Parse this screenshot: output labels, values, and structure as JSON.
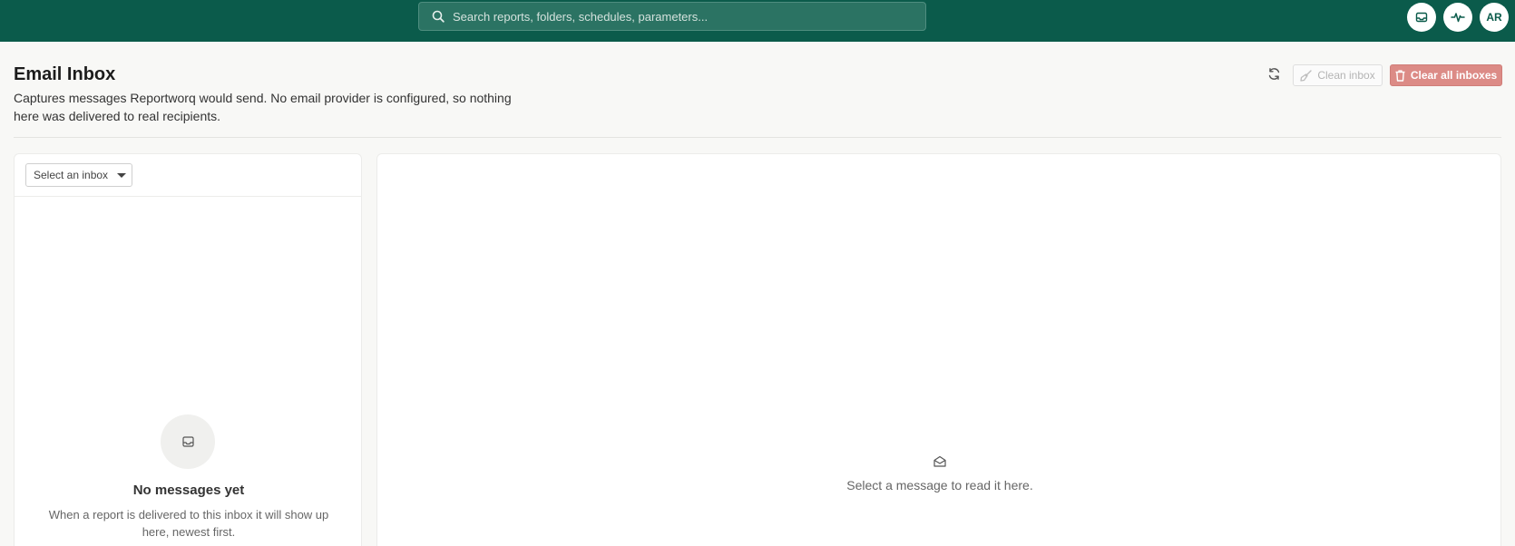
{
  "topbar": {
    "search_placeholder": "Search reports, folders, schedules, parameters...",
    "icons": [
      "inbox-icon",
      "activity-icon"
    ],
    "avatar_initials": "AR",
    "background_color": "#0b5b4b"
  },
  "header": {
    "title": "Email Inbox",
    "description": "Captures messages Reportworq would send. No email provider is configured, so nothing here was delivered to real recipients.",
    "refresh_icon": "refresh-icon",
    "clean_label": "Clean inbox",
    "clear_all_label": "Clear all inboxes",
    "danger_color": "#dc8b86"
  },
  "inbox_list": {
    "select_value": "Select an inbox",
    "empty_icon": "inbox-icon",
    "empty_title": "No messages yet",
    "empty_description": "When a report is delivered to this inbox it will show up here, newest first."
  },
  "reader": {
    "icon": "open-envelope-icon",
    "placeholder": "Select a message to read it here."
  }
}
